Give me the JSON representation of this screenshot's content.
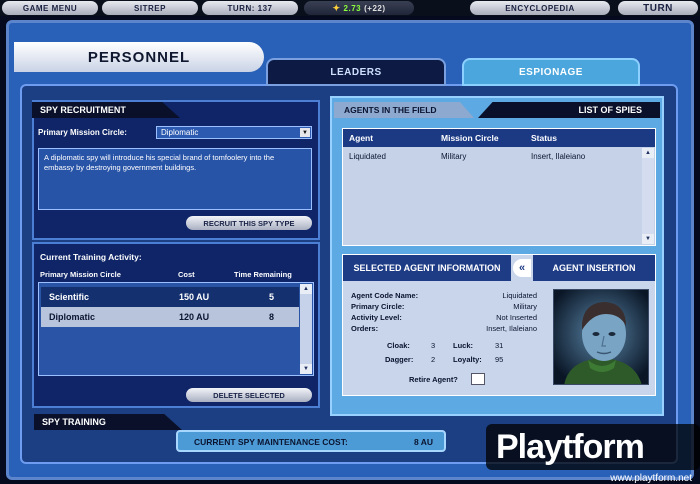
{
  "topbar": {
    "game_menu": "GAME MENU",
    "sitrep": "SITREP",
    "turn": "TURN: 137",
    "cash_amount": "2.73",
    "cash_gain": "(+22)",
    "encyclopedia": "ENCYCLOPEDIA",
    "end_turn": "TURN"
  },
  "screen": {
    "title": "PERSONNEL",
    "tabs": [
      {
        "label": "LEADERS",
        "active": false
      },
      {
        "label": "ESPIONAGE",
        "active": true
      }
    ]
  },
  "recruitment": {
    "header": "SPY RECRUITMENT",
    "mission_label": "Primary Mission Circle:",
    "mission_value": "Diplomatic",
    "description": "A diplomatic spy will introduce his special brand of tomfoolery into the embassy by destroying government buildings.",
    "recruit_button": "RECRUIT THIS SPY TYPE"
  },
  "training": {
    "activity_label": "Current Training Activity:",
    "columns": [
      "Primary Mission Circle",
      "Cost",
      "Time Remaining"
    ],
    "rows": [
      {
        "circle": "Scientific",
        "cost": "150 AU",
        "time": "5"
      },
      {
        "circle": "Diplomatic",
        "cost": "120 AU",
        "time": "8"
      }
    ],
    "delete_button": "DELETE SELECTED",
    "footer_header": "SPY TRAINING"
  },
  "agents": {
    "header": "AGENTS IN THE FIELD",
    "list_header": "LIST OF SPIES",
    "columns": [
      "Agent",
      "Mission Circle",
      "Status"
    ],
    "rows": [
      {
        "agent": "Liquidated",
        "circle": "Military",
        "status": "Insert, Ilaleiano"
      }
    ]
  },
  "selected_agent": {
    "header": "SELECTED AGENT INFORMATION",
    "toggle": "«",
    "insertion_header": "AGENT INSERTION",
    "code_name_label": "Agent Code Name:",
    "code_name": "Liquidated",
    "primary_circle_label": "Primary Circle:",
    "primary_circle": "Military",
    "activity_label": "Activity Level:",
    "activity": "Not Inserted",
    "orders_label": "Orders:",
    "orders": "Insert, Ilaleiano",
    "cloak_label": "Cloak:",
    "cloak": "3",
    "luck_label": "Luck:",
    "luck": "31",
    "dagger_label": "Dagger:",
    "dagger": "2",
    "loyalty_label": "Loyalty:",
    "loyalty": "95",
    "retire_label": "Retire Agent?"
  },
  "maintenance": {
    "label": "CURRENT SPY MAINTENANCE COST:",
    "value": "8 AU"
  },
  "watermark": {
    "logo": "Playtform",
    "url": "www.playtform.net"
  },
  "colors": {
    "frame": "#2a61b8",
    "panel": "#0f2568",
    "accent": "#5da9e4",
    "cash": "#8cff3c"
  }
}
